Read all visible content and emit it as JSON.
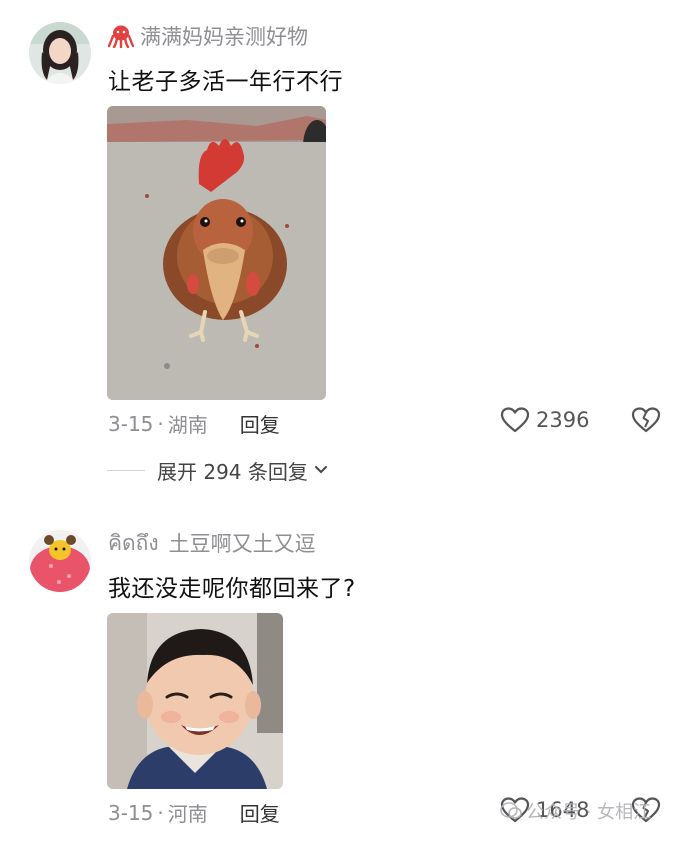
{
  "comments": [
    {
      "author": "满满妈妈亲测好物",
      "text": "让老子多活一年行不行",
      "date": "3-15",
      "location": "湖南",
      "reply_label": "回复",
      "likes": "2396",
      "replies_label": "展开 294 条回复"
    },
    {
      "author_prefix": "คิดถึง",
      "author": "土豆啊又土又逗",
      "text": "我还没走呢你都回来了?",
      "date": "3-15",
      "location": "河南",
      "reply_label": "回复",
      "likes": "1648"
    }
  ],
  "separator": "·",
  "watermark": "公众号 · 女相江",
  "icons": {
    "badge": "octopus-icon",
    "like": "heart-outline-icon",
    "dislike": "broken-heart-icon",
    "expand": "chevron-down-icon"
  }
}
